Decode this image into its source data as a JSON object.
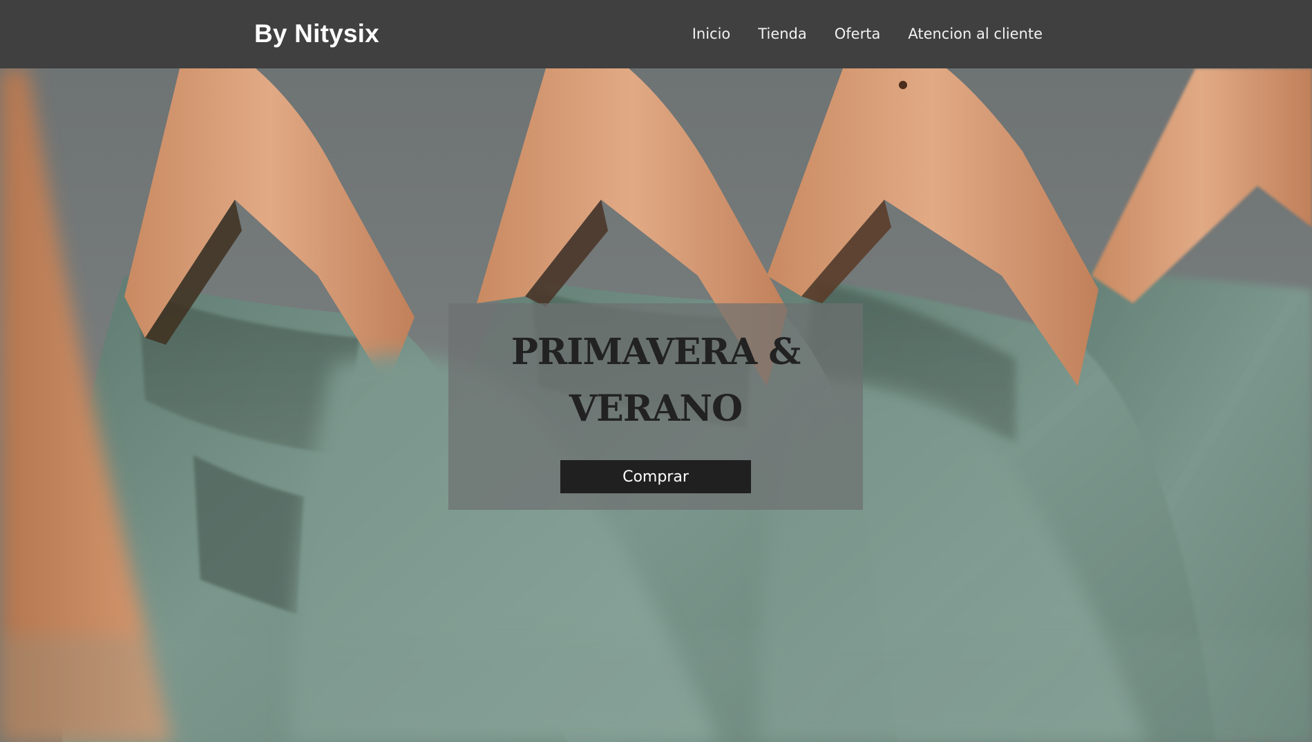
{
  "header": {
    "brand": "By Nitysix",
    "nav": [
      {
        "label": "Inicio"
      },
      {
        "label": "Tienda"
      },
      {
        "label": "Oferta"
      },
      {
        "label": "Atencion al cliente"
      }
    ]
  },
  "hero": {
    "image_description_icon": "photo-hanging-tshirts",
    "promo": {
      "title": "PRIMAVERA & VERANO",
      "button_label": "Comprar"
    }
  },
  "colors": {
    "header_bg": "#404040",
    "shirt_green": "#6f8a80",
    "hanger_wood": "#d9a07a",
    "button_bg": "#202020"
  }
}
